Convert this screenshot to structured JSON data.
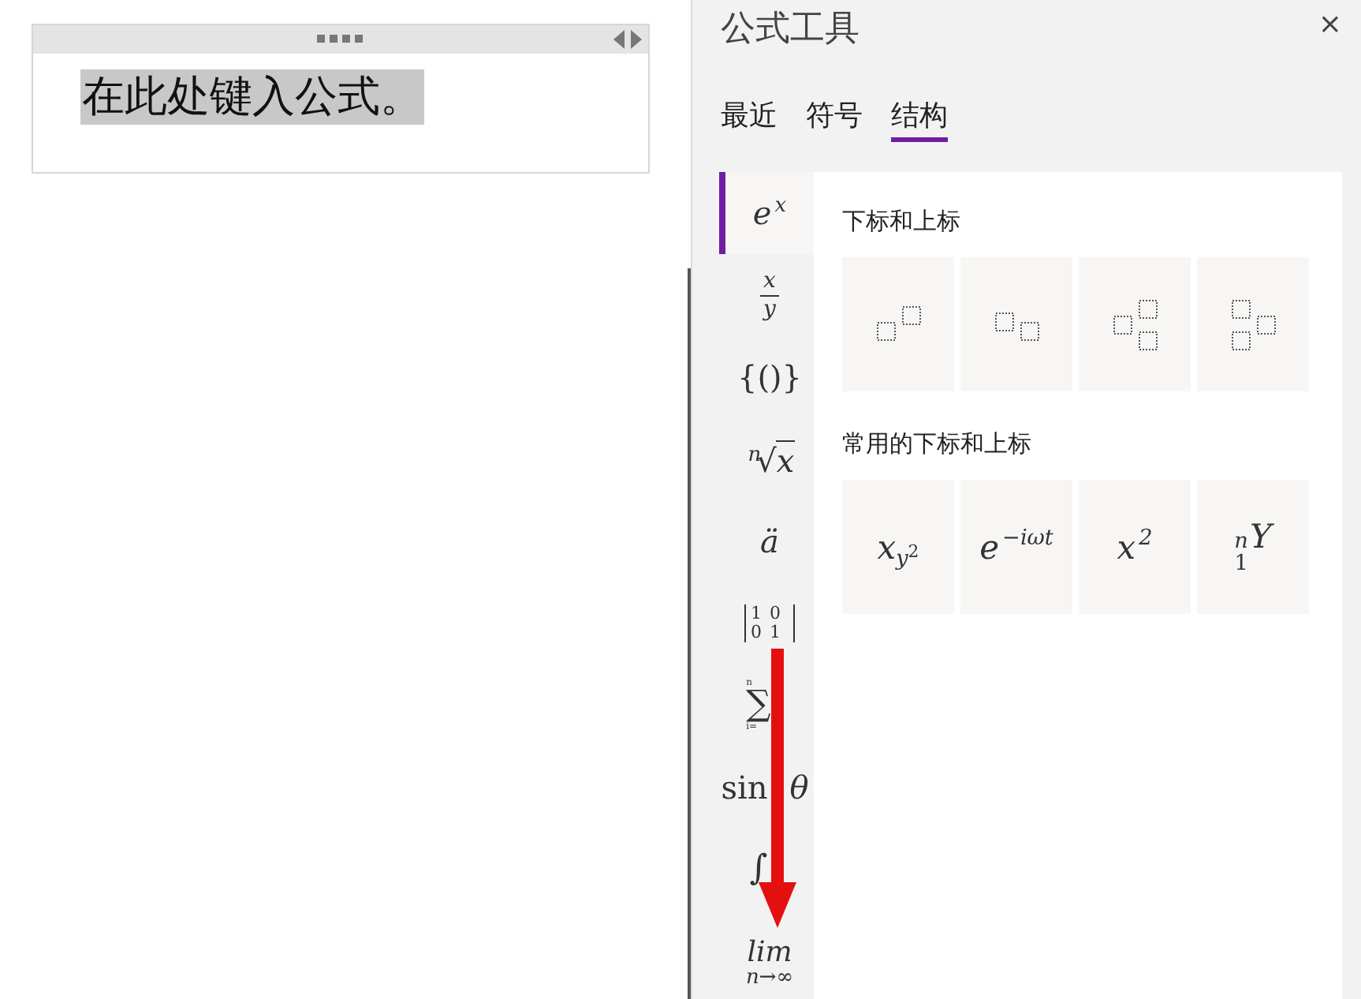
{
  "equation_box": {
    "placeholder_text": "在此处键入公式。"
  },
  "panel": {
    "title": "公式工具",
    "close": "×"
  },
  "tabs": [
    {
      "label": "最近",
      "selected": false
    },
    {
      "label": "符号",
      "selected": false
    },
    {
      "label": "结构",
      "selected": true
    }
  ],
  "categories": [
    {
      "kind": "script",
      "base": "e",
      "sup": "x",
      "selected": true
    },
    {
      "kind": "fraction",
      "num": "x",
      "den": "y",
      "selected": false
    },
    {
      "kind": "plain",
      "text": "{()}",
      "selected": false
    },
    {
      "kind": "radical",
      "index": "n",
      "radicand": "x",
      "sign": "√",
      "selected": false
    },
    {
      "kind": "accent",
      "text": "ä",
      "selected": false
    },
    {
      "kind": "matrix",
      "rows": [
        [
          "1",
          "0"
        ],
        [
          "0",
          "1"
        ]
      ],
      "selected": false
    },
    {
      "kind": "operator",
      "symbol": "∑",
      "over": "n",
      "under": "i=",
      "selected": false
    },
    {
      "kind": "function",
      "name": "sin",
      "arg": "θ",
      "selected": false
    },
    {
      "kind": "operator",
      "symbol": "∫",
      "selected": false
    },
    {
      "kind": "limit",
      "name": "lim",
      "under": "n→∞",
      "selected": false
    }
  ],
  "sections": [
    {
      "heading": "下标和上标",
      "tiles": [
        {
          "kind": "superscript"
        },
        {
          "kind": "subscript"
        },
        {
          "kind": "subsup"
        },
        {
          "kind": "left-subsup"
        }
      ]
    },
    {
      "heading": "常用的下标和上标",
      "tiles": [
        {
          "kind": "script",
          "base": "x",
          "sub": "y",
          "sub_sup": "2"
        },
        {
          "kind": "script",
          "base": "e",
          "sup": "−iωt"
        },
        {
          "kind": "script",
          "base": "x",
          "sup": "2"
        },
        {
          "kind": "prescript",
          "base": "Y",
          "pre_sup": "n",
          "pre_sub": "1"
        }
      ]
    }
  ]
}
